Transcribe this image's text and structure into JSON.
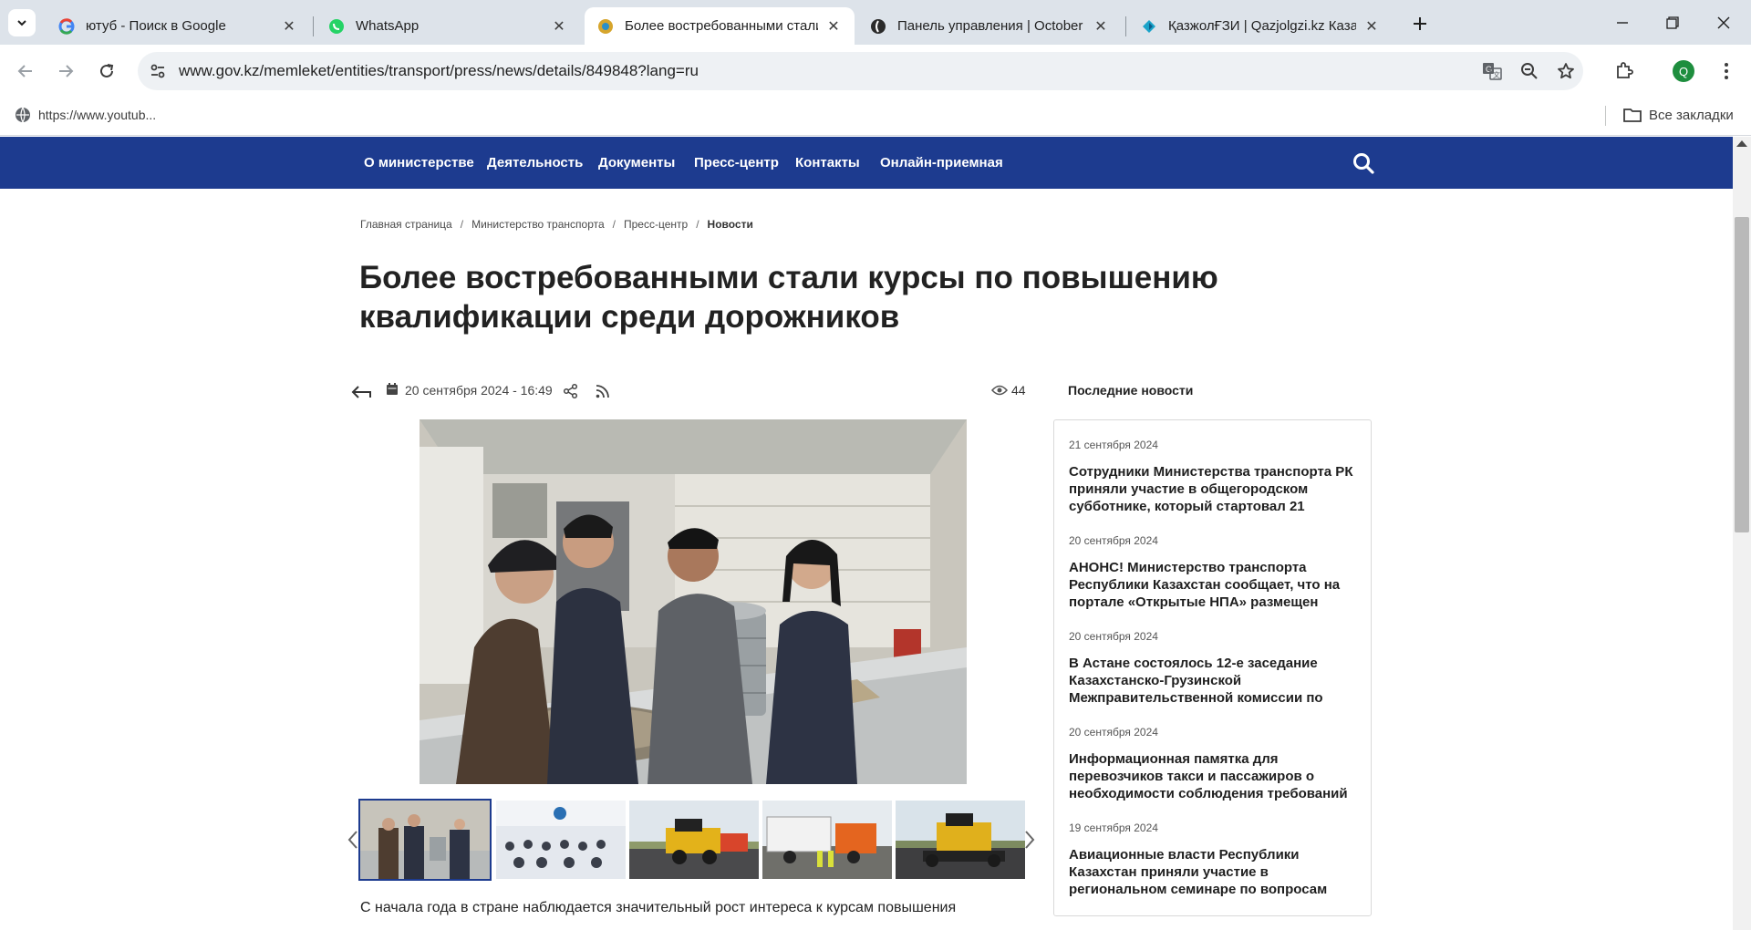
{
  "browser": {
    "tabs": [
      {
        "title": "ютуб - Поиск в Google",
        "favicon": "google-icon"
      },
      {
        "title": "WhatsApp",
        "favicon": "whatsapp-icon"
      },
      {
        "title": "Более востребованными стали",
        "favicon": "gov-kz-icon",
        "active": true
      },
      {
        "title": "Панель управления | October",
        "favicon": "october-icon"
      },
      {
        "title": "ҚазжолҒЗИ | Qazjolgzi.kz Каза",
        "favicon": "qazjol-icon"
      }
    ],
    "url": "www.gov.kz/memleket/entities/transport/press/news/details/849848?lang=ru",
    "profile_initial": "Q",
    "bookmark": "https://www.youtub...",
    "all_bookmarks": "Все закладки"
  },
  "site": {
    "nav": [
      "О министерстве",
      "Деятельность",
      "Документы",
      "Пресс-центр",
      "Контакты",
      "Онлайн-приемная"
    ],
    "breadcrumbs": [
      "Главная страница",
      "Министерство транспорта",
      "Пресс-центр",
      "Новости"
    ]
  },
  "article": {
    "title": "Более востребованными стали курсы по повышению квалификации среди дорожников",
    "date": "20 сентября 2024 - 16:49",
    "views": "44",
    "lead": "С начала года в стране наблюдается значительный рост интереса к курсам повышения"
  },
  "sidebar": {
    "title": "Последние новости",
    "news": [
      {
        "date": "21 сентября 2024",
        "headline": "Сотрудники Министерства транспорта РК приняли участие в общегородском субботнике, который стартовал 21"
      },
      {
        "date": "20 сентября 2024",
        "headline": "АНОНС! Министерство транспорта Республики Казахстан сообщает, что на портале «Открытые НПА» размещен"
      },
      {
        "date": "20 сентября 2024",
        "headline": "В Астане состоялось 12-е заседание Казахстанско-Грузинской Межправительственной комиссии по"
      },
      {
        "date": "20 сентября 2024",
        "headline": "Информационная памятка для перевозчиков такси и пассажиров о необходимости соблюдения требований"
      },
      {
        "date": "19 сентября 2024",
        "headline": "Авиационные власти Республики Казахстан приняли участие в региональном семинаре по вопросам"
      }
    ]
  },
  "colors": {
    "site_nav": "#1d3b8f",
    "tabbar": "#dde3ea",
    "omnibox": "#eef1f4"
  }
}
